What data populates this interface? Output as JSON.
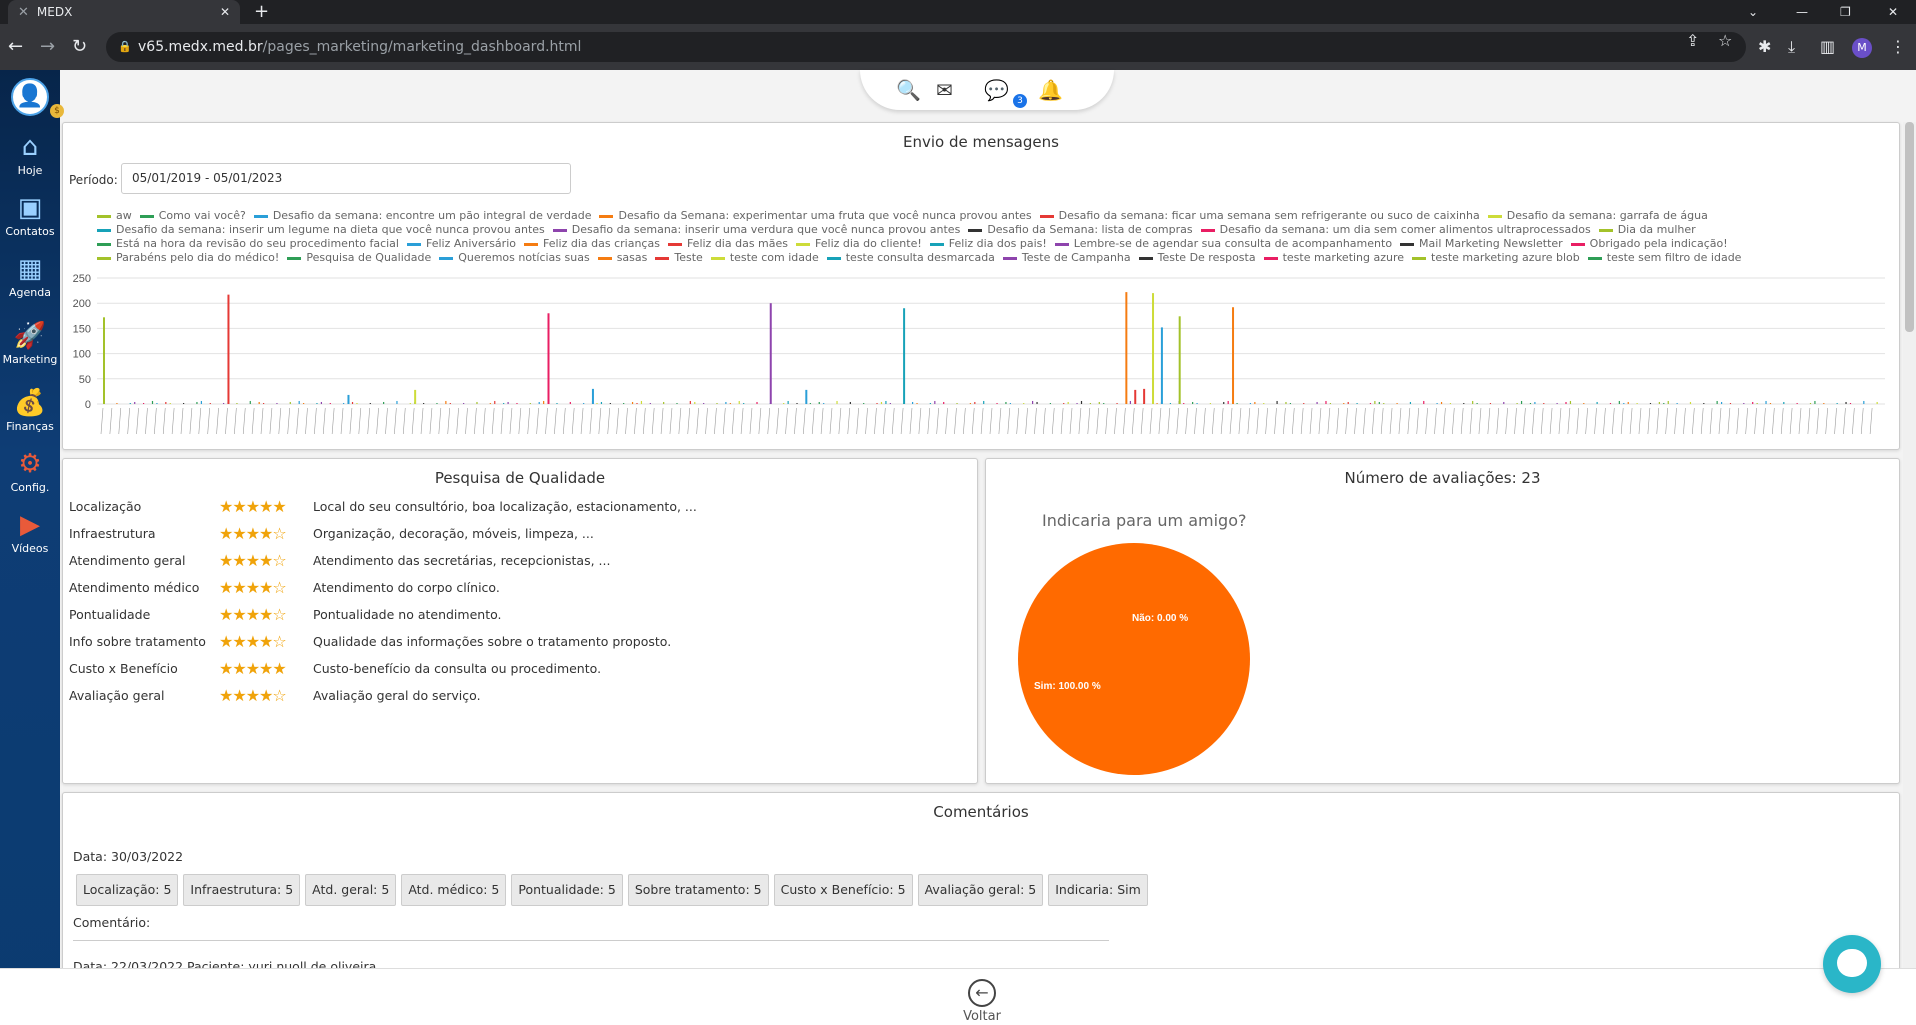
{
  "browser": {
    "tab_title": "MEDX",
    "tab_close": "✕",
    "new_tab": "+",
    "url_host": "v65.medx.med.br",
    "url_path": "/pages_marketing/marketing_dashboard.html",
    "profile_initial": "M"
  },
  "sidebar": {
    "items": [
      {
        "label": "Hoje",
        "icon": "home-icon"
      },
      {
        "label": "Contatos",
        "icon": "contacts-icon"
      },
      {
        "label": "Agenda",
        "icon": "calendar-icon"
      },
      {
        "label": "Marketing",
        "icon": "rocket-icon"
      },
      {
        "label": "Finanças",
        "icon": "money-bag-icon"
      },
      {
        "label": "Config.",
        "icon": "gear-icon"
      },
      {
        "label": "Vídeos",
        "icon": "video-icon"
      }
    ]
  },
  "notifications": {
    "chat_badge": "3"
  },
  "envio": {
    "title": "Envio de mensagens",
    "periodo_label": "Período:",
    "periodo_value": "05/01/2019 - 05/01/2023",
    "legend": [
      {
        "name": "aw",
        "color": "#a3c22a"
      },
      {
        "name": "Como vai você?",
        "color": "#2e9e56"
      },
      {
        "name": "Desafio da semana: encontre um pão integral de verdade",
        "color": "#2a9fd8"
      },
      {
        "name": "Desafio da Semana: experimentar uma fruta que você nunca provou antes",
        "color": "#f57c12"
      },
      {
        "name": "Desafio da semana: ficar uma semana sem refrigerante ou suco de caixinha",
        "color": "#e53935"
      },
      {
        "name": "Desafio da semana: garrafa de água",
        "color": "#cddc39"
      },
      {
        "name": "Desafio da semana: inserir um legume na dieta que você nunca provou antes",
        "color": "#17a2b8"
      },
      {
        "name": "Desafio da semana: inserir uma verdura que você nunca provou antes",
        "color": "#8e44ad"
      },
      {
        "name": "Desafio da Semana: lista de compras",
        "color": "#333333"
      },
      {
        "name": "Desafio da semana: um dia sem comer alimentos ultraprocessados",
        "color": "#e91e63"
      },
      {
        "name": "Dia da mulher",
        "color": "#a3c22a"
      },
      {
        "name": "Está na hora da revisão do seu procedimento facial",
        "color": "#2e9e56"
      },
      {
        "name": "Feliz Aniversário",
        "color": "#2a9fd8"
      },
      {
        "name": "Feliz dia das crianças",
        "color": "#f57c12"
      },
      {
        "name": "Feliz dia das mães",
        "color": "#e53935"
      },
      {
        "name": "Feliz dia do cliente!",
        "color": "#cddc39"
      },
      {
        "name": "Feliz dia dos pais!",
        "color": "#17a2b8"
      },
      {
        "name": "Lembre-se de agendar sua consulta de acompanhamento",
        "color": "#8e44ad"
      },
      {
        "name": "Mail Marketing Newsletter",
        "color": "#333333"
      },
      {
        "name": "Obrigado pela indicação!",
        "color": "#e91e63"
      },
      {
        "name": "Parabéns pelo dia do médico!",
        "color": "#a3c22a"
      },
      {
        "name": "Pesquisa de Qualidade",
        "color": "#2e9e56"
      },
      {
        "name": "Queremos notícias suas",
        "color": "#2a9fd8"
      },
      {
        "name": "sasas",
        "color": "#f57c12"
      },
      {
        "name": "Teste",
        "color": "#e53935"
      },
      {
        "name": "teste com idade",
        "color": "#cddc39"
      },
      {
        "name": "teste consulta desmarcada",
        "color": "#17a2b8"
      },
      {
        "name": "Teste de Campanha",
        "color": "#8e44ad"
      },
      {
        "name": "Teste De resposta",
        "color": "#333333"
      },
      {
        "name": "teste marketing azure",
        "color": "#e91e63"
      },
      {
        "name": "teste marketing azure blob",
        "color": "#a3c22a"
      },
      {
        "name": "teste sem filtro de idade",
        "color": "#2e9e56"
      }
    ]
  },
  "chart_data": {
    "type": "bar",
    "ylim": [
      0,
      250
    ],
    "yticks": [
      "250",
      "200",
      "150",
      "100",
      "50",
      "0"
    ],
    "n_categories": 400,
    "spikes": [
      {
        "index": 0,
        "value": 172,
        "color": "#a3c22a"
      },
      {
        "index": 28,
        "value": 217,
        "color": "#e53935"
      },
      {
        "index": 100,
        "value": 180,
        "color": "#e91e63"
      },
      {
        "index": 150,
        "value": 200,
        "color": "#8e44ad"
      },
      {
        "index": 180,
        "value": 190,
        "color": "#17a2b8"
      },
      {
        "index": 230,
        "value": 222,
        "color": "#f57c12"
      },
      {
        "index": 232,
        "value": 28,
        "color": "#e53935"
      },
      {
        "index": 234,
        "value": 30,
        "color": "#e53935"
      },
      {
        "index": 236,
        "value": 220,
        "color": "#cddc39"
      },
      {
        "index": 238,
        "value": 152,
        "color": "#2a9fd8"
      },
      {
        "index": 242,
        "value": 174,
        "color": "#a3c22a"
      },
      {
        "index": 254,
        "value": 192,
        "color": "#f57c12"
      },
      {
        "index": 55,
        "value": 18,
        "color": "#2a9fd8"
      },
      {
        "index": 70,
        "value": 28,
        "color": "#cddc39"
      },
      {
        "index": 110,
        "value": 30,
        "color": "#2a9fd8"
      },
      {
        "index": 158,
        "value": 28,
        "color": "#2a9fd8"
      }
    ]
  },
  "pesquisa": {
    "title": "Pesquisa de Qualidade",
    "rows": [
      {
        "label": "Localização",
        "stars": 5,
        "desc": "Local do seu consultório, boa localização, estacionamento, ..."
      },
      {
        "label": "Infraestrutura",
        "stars": 4,
        "desc": "Organização, decoração, móveis, limpeza, ..."
      },
      {
        "label": "Atendimento geral",
        "stars": 4,
        "desc": "Atendimento das secretárias, recepcionistas, ..."
      },
      {
        "label": "Atendimento médico",
        "stars": 4,
        "desc": "Atendimento do corpo clínico."
      },
      {
        "label": "Pontualidade",
        "stars": 4,
        "desc": "Pontualidade no atendimento."
      },
      {
        "label": "Info sobre tratamento",
        "stars": 4,
        "desc": "Qualidade das informações sobre o tratamento proposto."
      },
      {
        "label": "Custo x Benefício",
        "stars": 5,
        "desc": "Custo-benefício da consulta ou procedimento."
      },
      {
        "label": "Avaliação geral",
        "stars": 4,
        "desc": "Avaliação geral do serviço."
      }
    ]
  },
  "avaliacoes": {
    "title": "Número de avaliações: 23",
    "pie_title": "Indicaria para um amigo?",
    "pie": {
      "type": "pie",
      "slices": [
        {
          "label": "Sim: 100.00 %",
          "value": 100,
          "color": "#ff6a00"
        },
        {
          "label": "Não: 0.00 %",
          "value": 0,
          "color": "#ff6a00"
        }
      ]
    }
  },
  "comentarios": {
    "title": "Comentários",
    "data_line": "Data: 30/03/2022",
    "cards": [
      "Localização: 5",
      "Infraestrutura: 5",
      "Atd. geral: 5",
      "Atd. médico: 5",
      "Pontualidade: 5",
      "Sobre tratamento: 5",
      "Custo x Benefício: 5",
      "Avaliação geral: 5",
      "Indicaria: Sim"
    ],
    "comment_label": "Comentário:",
    "data2_line": "Data: 22/03/2022 Paciente: yuri nuoll de oliveira"
  },
  "footer": {
    "back_label": "Voltar"
  }
}
